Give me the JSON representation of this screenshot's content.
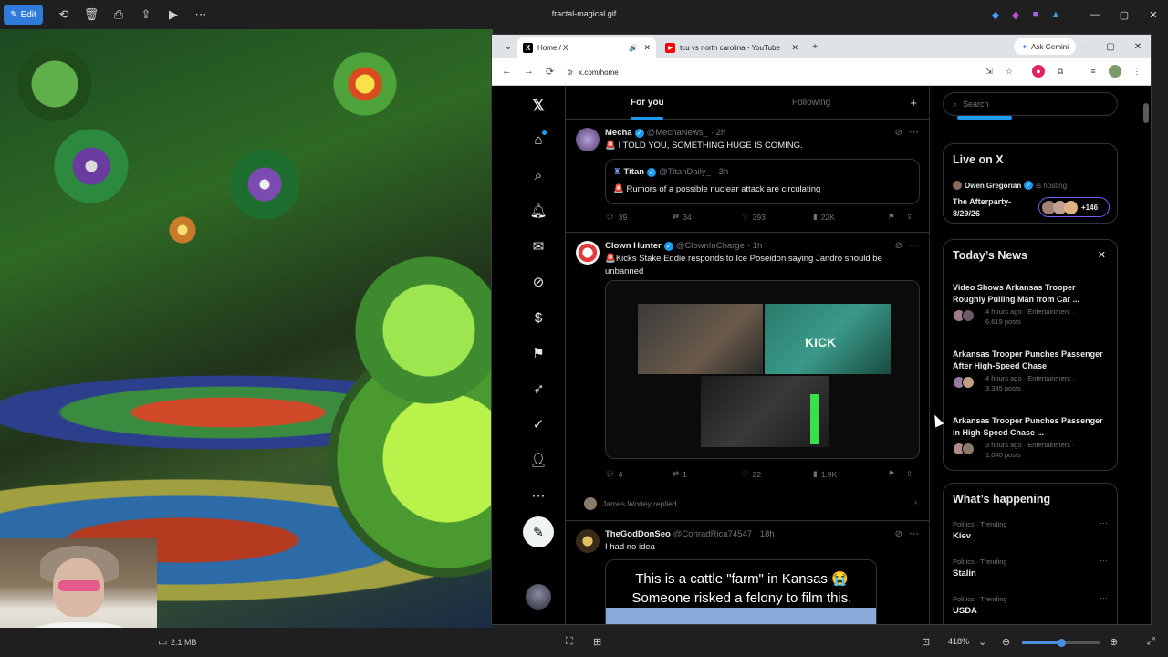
{
  "viewer": {
    "edit_label": "Edit",
    "file_title": "fractal-magical.gif",
    "file_size": "2.1 MB",
    "zoom": "418%",
    "zoom_fraction": 0.5
  },
  "browser": {
    "tabs": [
      {
        "label": "Home / X",
        "active": true
      },
      {
        "label": "tcu vs north carolina - YouTube",
        "active": false
      }
    ],
    "gemini_label": "Ask Gemini",
    "url": "x.com/home"
  },
  "x": {
    "tabs": {
      "for_you": "For you",
      "following": "Following"
    },
    "tweets": [
      {
        "name": "Mecha",
        "handle": "@MechaNews_",
        "time": "· 2h",
        "text": "🚨 I TOLD YOU, SOMETHING HUGE IS COMING.",
        "quote": {
          "name": "Titan",
          "handle": "@TitanDaily_",
          "time": "· 3h",
          "text": "🚨 Rumors of a possible nuclear attack are circulating"
        },
        "replies": "39",
        "reposts": "34",
        "likes": "393",
        "views": "22K"
      },
      {
        "name": "Clown Hunter",
        "handle": "@ClownInCharge",
        "time": "· 1h",
        "text": "🚨Kicks Stake Eddie responds to Ice Poseidon saying Jandro should be unbanned",
        "media_caption": "KICK",
        "replies": "4",
        "reposts": "1",
        "likes": "22",
        "views": "1.9K",
        "replied_by": "James Worley replied"
      },
      {
        "name": "TheGodDonSeo",
        "handle": "@ConradRica74547",
        "time": "· 18h",
        "text": "I had no idea",
        "media_line1": "This is a cattle \"farm\" in Kansas 😭",
        "media_line2": "Someone risked a felony to film this."
      }
    ],
    "search_placeholder": "Search",
    "live": {
      "title": "Live on X",
      "host": "Owen Gregorian",
      "host_suffix": "is hosting",
      "space_title": "The Afterparty- 8/29/26",
      "listeners": "+146"
    },
    "news": {
      "title": "Today’s News",
      "items": [
        {
          "title": "Video Shows Arkansas Trooper Roughly Pulling Man from Car ...",
          "meta1": "4 hours ago · Entertainment ·",
          "meta2": "6,619 posts"
        },
        {
          "title": "Arkansas Trooper Punches Passenger After High-Speed Chase",
          "meta1": "4 hours ago · Entertainment ·",
          "meta2": "3,345 posts"
        },
        {
          "title": "Arkansas Trooper Punches Passenger in High-Speed Chase ...",
          "meta1": "3 hours ago · Entertainment ·",
          "meta2": "1,040 posts"
        }
      ]
    },
    "happening": {
      "title": "What’s happening",
      "trends": [
        {
          "category": "Politics · Trending",
          "name": "Kiev"
        },
        {
          "category": "Politics · Trending",
          "name": "Stalin"
        },
        {
          "category": "Politics · Trending",
          "name": "USDA"
        }
      ]
    }
  },
  "colors": {
    "x_blue": "#1d9bf0",
    "viewer_accent": "#2f7bd9",
    "bg": "#000000"
  }
}
